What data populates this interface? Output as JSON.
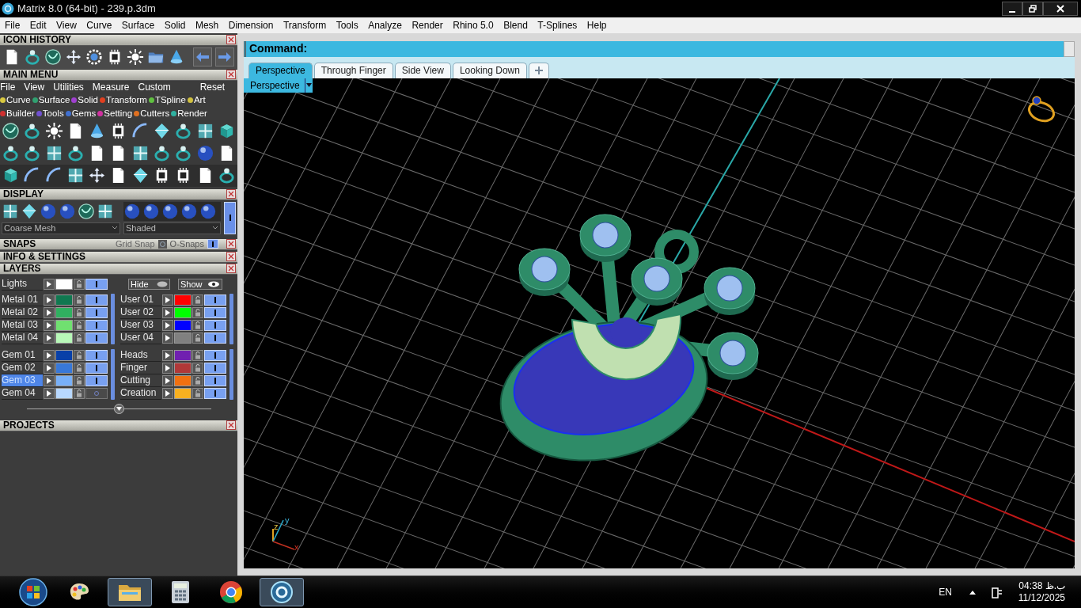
{
  "window": {
    "title": "Matrix 8.0 (64-bit) - 239.p.3dm"
  },
  "menu_bar": [
    "File",
    "Edit",
    "View",
    "Curve",
    "Surface",
    "Solid",
    "Mesh",
    "Dimension",
    "Transform",
    "Tools",
    "Analyze",
    "Render",
    "Rhino 5.0",
    "Blend",
    "T-Splines",
    "Help"
  ],
  "icon_history": {
    "title": "ICON HISTORY"
  },
  "main_menu": {
    "title": "MAIN MENU",
    "menu": [
      "File",
      "View",
      "Utilities",
      "Measure",
      "Custom"
    ],
    "reset": "Reset",
    "categories": [
      {
        "label": "Curve",
        "color": "#d8c840"
      },
      {
        "label": "Surface",
        "color": "#30a070"
      },
      {
        "label": "Solid",
        "color": "#a040d0"
      },
      {
        "label": "Transform",
        "color": "#e04020"
      },
      {
        "label": "TSpline",
        "color": "#60c040"
      },
      {
        "label": "Art",
        "color": "#d0c040"
      },
      {
        "label": "Builder",
        "color": "#d03030"
      },
      {
        "label": "Tools",
        "color": "#7050d0"
      },
      {
        "label": "Gems",
        "color": "#4070d0"
      },
      {
        "label": "Setting",
        "color": "#d030a0"
      },
      {
        "label": "Cutters",
        "color": "#e07020"
      },
      {
        "label": "Render",
        "color": "#30b0a0"
      }
    ]
  },
  "display": {
    "title": "DISPLAY",
    "mesh": "Coarse Mesh",
    "shading": "Shaded"
  },
  "snaps": {
    "title": "SNAPS",
    "grid_snap": "Grid Snap",
    "osnaps": "O-Snaps"
  },
  "info_settings": {
    "title": "INFO & SETTINGS"
  },
  "layers": {
    "title": "LAYERS",
    "hide": "Hide",
    "show": "Show",
    "lights": {
      "name": "Lights",
      "color": "#ffffff",
      "selected": false,
      "on": true
    },
    "groups": [
      [
        {
          "name": "Metal 01",
          "color": "#107850",
          "selected": false,
          "on": true
        },
        {
          "name": "Metal 02",
          "color": "#30b060",
          "selected": false,
          "on": true
        },
        {
          "name": "Metal 03",
          "color": "#70e070",
          "selected": false,
          "on": true
        },
        {
          "name": "Metal 04",
          "color": "#b8f8b8",
          "selected": false,
          "on": true
        }
      ],
      [
        {
          "name": "User 01",
          "color": "#ff0000",
          "selected": false,
          "on": true
        },
        {
          "name": "User 02",
          "color": "#00ff00",
          "selected": false,
          "on": true
        },
        {
          "name": "User 03",
          "color": "#0000ff",
          "selected": false,
          "on": true
        },
        {
          "name": "User 04",
          "color": "#808080",
          "selected": false,
          "on": true
        }
      ],
      [
        {
          "name": "Gem 01",
          "color": "#0840a8",
          "selected": false,
          "on": true
        },
        {
          "name": "Gem 02",
          "color": "#3878d8",
          "selected": false,
          "on": true
        },
        {
          "name": "Gem 03",
          "color": "#78b0f8",
          "selected": true,
          "on": true
        },
        {
          "name": "Gem 04",
          "color": "#b8d8ff",
          "selected": false,
          "on": false
        }
      ],
      [
        {
          "name": "Heads",
          "color": "#7020b0",
          "selected": false,
          "on": true
        },
        {
          "name": "Finger",
          "color": "#b03838",
          "selected": false,
          "on": true
        },
        {
          "name": "Cutting",
          "color": "#f07010",
          "selected": false,
          "on": true
        },
        {
          "name": "Creation",
          "color": "#f8b020",
          "selected": false,
          "on": true
        }
      ]
    ]
  },
  "projects": {
    "title": "PROJECTS"
  },
  "command": {
    "label": "Command:"
  },
  "tabs": [
    {
      "label": "Perspective",
      "selected": true
    },
    {
      "label": "Through Finger",
      "selected": false
    },
    {
      "label": "Side View",
      "selected": false
    },
    {
      "label": "Looking Down",
      "selected": false
    }
  ],
  "viewport": {
    "label": "Perspective",
    "axes": [
      "z",
      "y",
      "x"
    ]
  },
  "taskbar": {
    "apps": [
      {
        "kind": "palette",
        "selected": false
      },
      {
        "kind": "folder",
        "selected": true
      },
      {
        "kind": "calculator",
        "selected": false
      },
      {
        "kind": "browser",
        "selected": false
      },
      {
        "kind": "app",
        "selected": true
      }
    ],
    "language": "EN",
    "time": "ب.ظ 04:38",
    "date": "11/12/2025"
  }
}
